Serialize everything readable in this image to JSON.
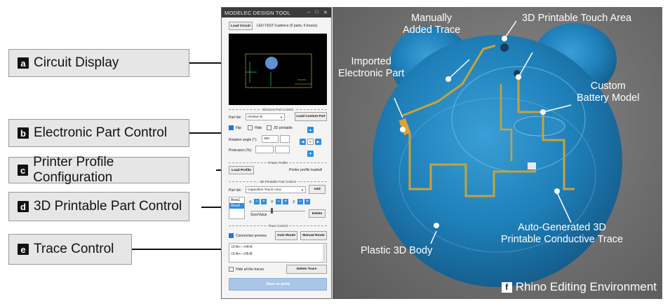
{
  "callouts": [
    {
      "letter": "a",
      "label": "Circuit Display"
    },
    {
      "letter": "b",
      "label": "Electronic Part Control"
    },
    {
      "letter": "c",
      "label": "Printer Profile Configuration"
    },
    {
      "letter": "d",
      "label": "3D Printable Part Control"
    },
    {
      "letter": "e",
      "label": "Trace Control"
    }
  ],
  "window": {
    "title": "MODELEC DESIGN TOOL",
    "controls": {
      "minimize": "–",
      "maximize": "□",
      "close": "✕"
    },
    "load_circuit": "Load Circuit",
    "circuit_name": "LED-TEST-Cadence (5 parts, 6 traces)",
    "electronic_section": "Electroni Part Control",
    "part_list_label": "Part list:",
    "part_list_value": "resistor-i5",
    "load_custom_part": "Load Custom Part",
    "flip_label": "Flip",
    "hide_label": "Hide",
    "printable_label": "3D printable",
    "rotation_label": "Rotation angle (°):",
    "rotation_value": "360",
    "protrusion_label": "Protrusion (%):",
    "printer_section": "Printer Profile",
    "load_profile": "Load Profile",
    "profile_status": "Printer profile loaded!",
    "printable_section": "3D-Printable Part Control",
    "part_list2_label": "Part list:",
    "part_list2_value": "Capacitive Touch Area",
    "add_button": "Add",
    "areas": [
      "Area1",
      "Area2"
    ],
    "x_label": "X:",
    "y_label": "Y:",
    "z_label": "Z:",
    "size_label": "Size/Value",
    "delete_button": "Delete",
    "trace_section": "Trace Control",
    "connection_preview": "Connection preview",
    "auto_route": "Auto-Route",
    "manual_route": "Manual Route",
    "traces": [
      "I3-N<--->I4-A",
      "I3-N<--->I5-B"
    ],
    "hide_traces": "Hide all the traces",
    "delete_trace": "Delete Trace",
    "save_to_print": "Save to print"
  },
  "view": {
    "labels": {
      "manual_trace": [
        "Manually",
        "Added Trace"
      ],
      "touch_area": "3D Printable Touch Area",
      "imported_part": [
        "Imported",
        "Electronic Part"
      ],
      "battery": [
        "Custom",
        "Battery Model"
      ],
      "auto_trace": [
        "Auto-Generated 3D",
        "Printable Conductive Trace"
      ],
      "body": "Plastic 3D Body"
    },
    "title_letter": "f",
    "title": "Rhino Editing Environment"
  },
  "colors": {
    "accent": "#2f8de4",
    "body": "#1f7fb8",
    "trace": "#c9a23a"
  }
}
